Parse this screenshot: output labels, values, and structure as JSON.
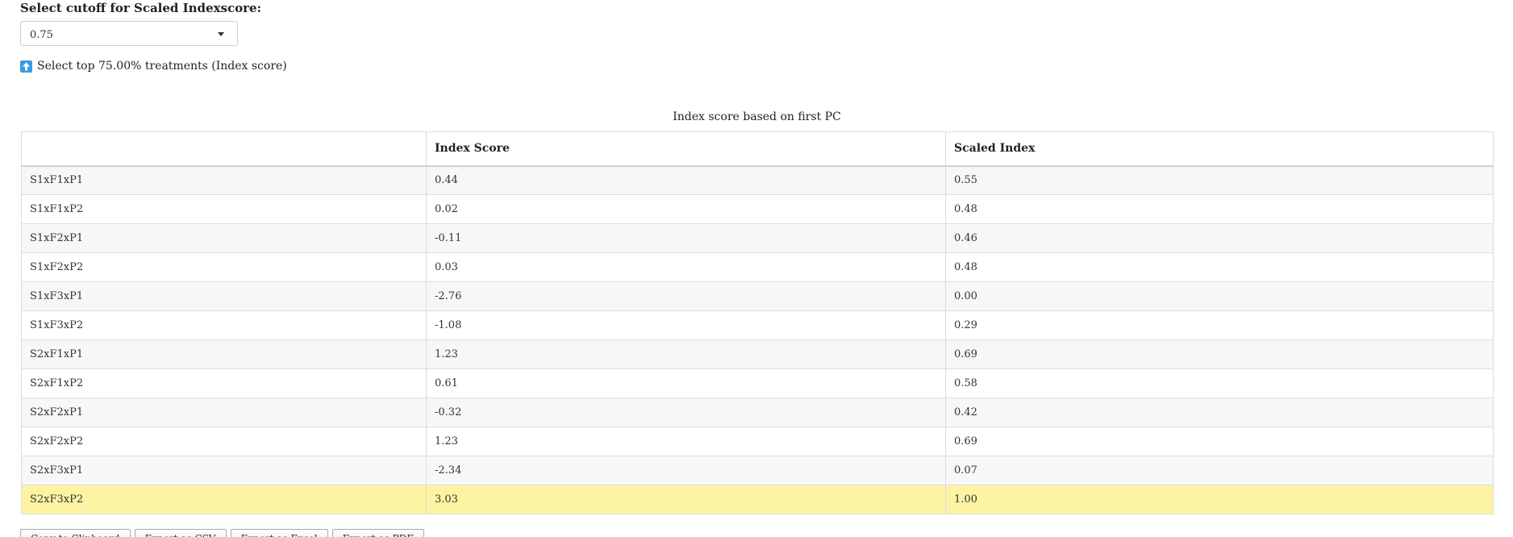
{
  "cutoff": {
    "label": "Select cutoff for Scaled Indexscore:",
    "selected_value": "0.75"
  },
  "hint": {
    "icon": "up-arrow-icon",
    "text": "Select top 75.00% treatments (Index score)"
  },
  "table": {
    "caption": "Index score based on first PC",
    "columns": [
      "",
      "Index Score",
      "Scaled Index"
    ],
    "rows": [
      {
        "name": "S1xF1xP1",
        "index_score": "0.44",
        "scaled_index": "0.55"
      },
      {
        "name": "S1xF1xP2",
        "index_score": "0.02",
        "scaled_index": "0.48"
      },
      {
        "name": "S1xF2xP1",
        "index_score": "-0.11",
        "scaled_index": "0.46"
      },
      {
        "name": "S1xF2xP2",
        "index_score": "0.03",
        "scaled_index": "0.48"
      },
      {
        "name": "S1xF3xP1",
        "index_score": "-2.76",
        "scaled_index": "0.00"
      },
      {
        "name": "S1xF3xP2",
        "index_score": "-1.08",
        "scaled_index": "0.29"
      },
      {
        "name": "S2xF1xP1",
        "index_score": "1.23",
        "scaled_index": "0.69"
      },
      {
        "name": "S2xF1xP2",
        "index_score": "0.61",
        "scaled_index": "0.58"
      },
      {
        "name": "S2xF2xP1",
        "index_score": "-0.32",
        "scaled_index": "0.42"
      },
      {
        "name": "S2xF2xP2",
        "index_score": "1.23",
        "scaled_index": "0.69"
      },
      {
        "name": "S2xF3xP1",
        "index_score": "-2.34",
        "scaled_index": "0.07"
      },
      {
        "name": "S2xF3xP2",
        "index_score": "3.03",
        "scaled_index": "1.00"
      }
    ],
    "highlight_color": "#fdf4a3"
  },
  "export_buttons": [
    "Copy to Clipboard",
    "Export as CSV",
    "Export as Excel",
    "Export as PDF"
  ]
}
